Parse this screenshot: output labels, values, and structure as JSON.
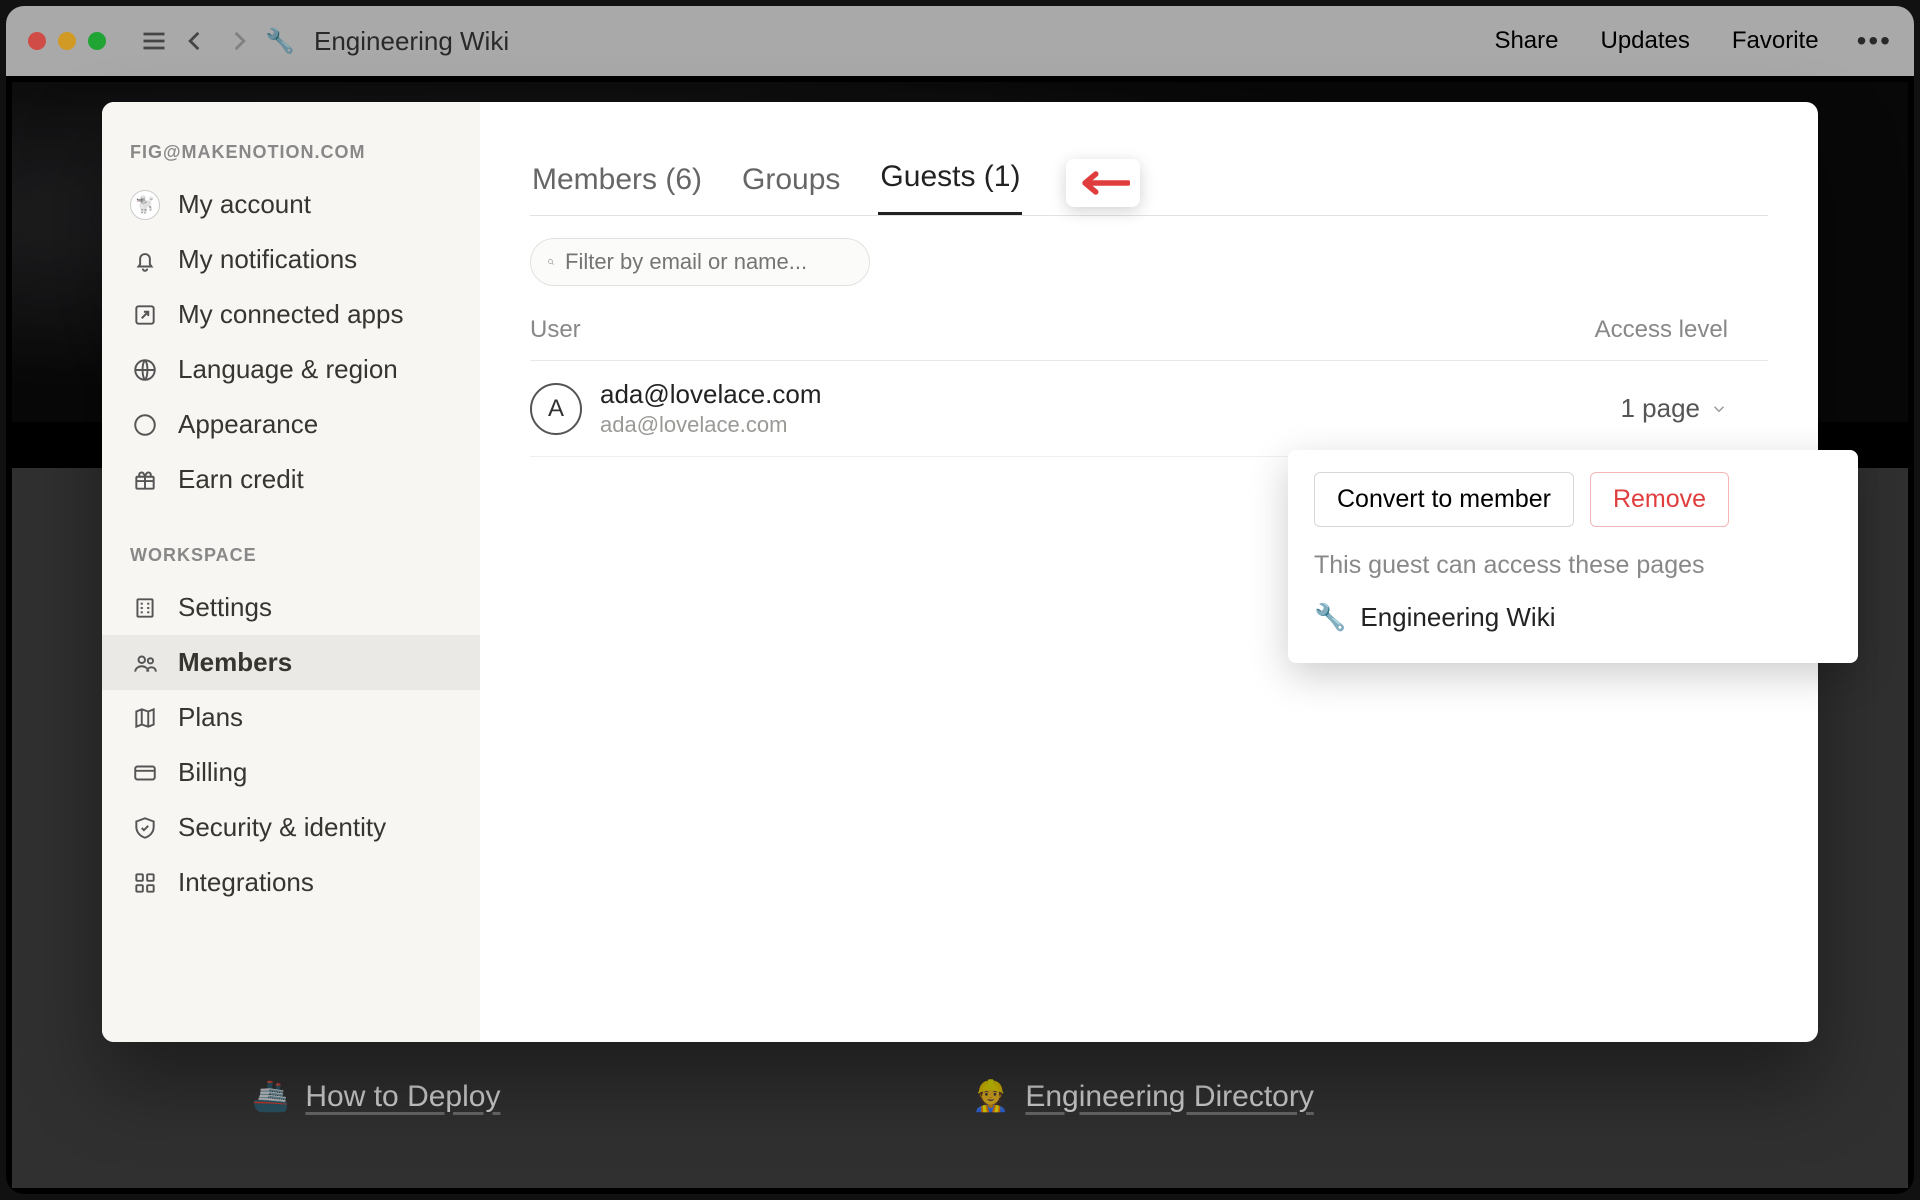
{
  "window": {
    "page_emoji": "🔧",
    "page_title": "Engineering Wiki",
    "menu": {
      "share": "Share",
      "updates": "Updates",
      "favorite": "Favorite"
    }
  },
  "underneath": {
    "left": {
      "emoji": "🚢",
      "label": "How to Deploy"
    },
    "right": {
      "emoji": "👷",
      "label": "Engineering Directory"
    }
  },
  "sidebar": {
    "account_header": "FIG@MAKENOTION.COM",
    "account": [
      {
        "label": "My account"
      },
      {
        "label": "My notifications"
      },
      {
        "label": "My connected apps"
      },
      {
        "label": "Language & region"
      },
      {
        "label": "Appearance"
      },
      {
        "label": "Earn credit"
      }
    ],
    "workspace_header": "WORKSPACE",
    "workspace": [
      {
        "label": "Settings"
      },
      {
        "label": "Members"
      },
      {
        "label": "Plans"
      },
      {
        "label": "Billing"
      },
      {
        "label": "Security & identity"
      },
      {
        "label": "Integrations"
      }
    ],
    "active_workspace_index": 1
  },
  "tabs": {
    "members": "Members (6)",
    "groups": "Groups",
    "guests": "Guests (1)",
    "active": "guests"
  },
  "search": {
    "placeholder": "Filter by email or name..."
  },
  "columns": {
    "user": "User",
    "access": "Access level"
  },
  "guests": [
    {
      "initial": "A",
      "name": "ada@lovelace.com",
      "email": "ada@lovelace.com",
      "access": "1 page"
    }
  ],
  "popover": {
    "convert": "Convert to member",
    "remove": "Remove",
    "note": "This guest can access these pages",
    "pages": [
      {
        "emoji": "🔧",
        "title": "Engineering Wiki"
      }
    ]
  },
  "colors": {
    "accent_red": "#e03e3e"
  }
}
